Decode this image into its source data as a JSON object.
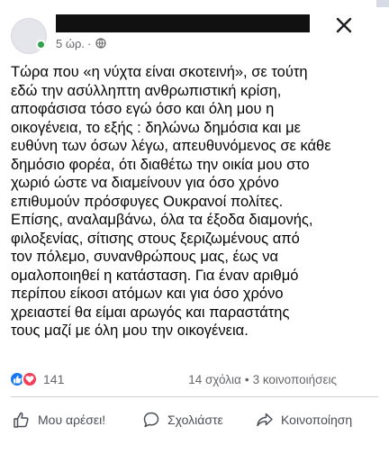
{
  "post": {
    "time": "5 ώρ.",
    "separator": "·",
    "text": "Τώρα που «η νύχτα είναι σκοτεινή», σε τούτη\nεδώ την ασύλληπτη ανθρωπιστική κρίση,\nαποφάσισα τόσο εγώ όσο και όλη μου η\nοικογένεια, το εξής : δηλώνω δημόσια και με\nευθύνη των όσων λέγω, απευθυνόμενος σε κάθε\nδημόσιο φορέα, ότι  διαθέτω την οικία μου στο\nχωριό ώστε να διαμείνουν για όσο χρόνο\nεπιθυμούν πρόσφυγες Ουκρανοί πολίτες.\nΕπίσης, αναλαμβάνω, όλα τα έξοδα διαμονής,\nφιλοξενίας, σίτισης στους  ξεριζωμένους από\nτον πόλεμο, συνανθρώπους μας, έως να\nομαλοποιηθεί η κατάσταση. Για έναν αριθμό\nπερίπου είκοσι ατόμων και για όσο χρόνο\nχρειαστεί θα είμαι αρωγός και παραστάτης\nτους μαζί με όλη μου την οικογένεια."
  },
  "stats": {
    "reaction_count": "141",
    "comments": "14 σχόλια",
    "dot": "•",
    "shares": "3 κοινοποιήσεις"
  },
  "actions": {
    "like_label": "Μου αρέσει!",
    "comment_label": "Σχολιάστε",
    "share_label": "Κοινοποίηση"
  },
  "colors": {
    "like_blue": "#1877f2",
    "love_red": "#f33e58",
    "online_green": "#31a24c",
    "secondary_text": "#65676b"
  }
}
